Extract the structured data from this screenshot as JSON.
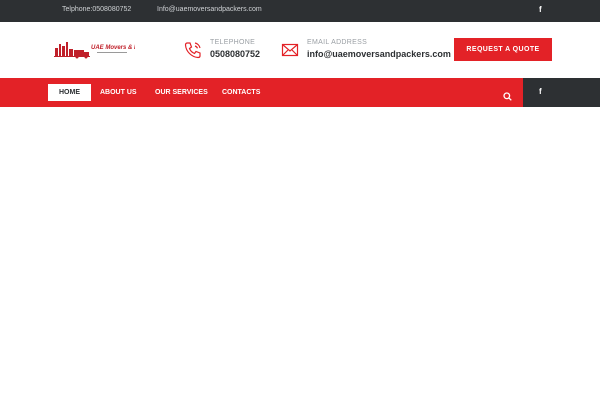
{
  "topbar": {
    "phone_text": "Telphone:0508080752",
    "email_text": "Info@uaemoversandpackers.com",
    "facebook_glyph": "f"
  },
  "header": {
    "telephone_label": "TELEPHONE",
    "telephone_value": "0508080752",
    "email_label": "EMAIL ADDRESS",
    "email_value": "info@uaemoversandpackers.com",
    "quote_button": "REQUEST A QUOTE"
  },
  "nav": {
    "items": [
      {
        "label": "HOME"
      },
      {
        "label": "ABOUT US"
      },
      {
        "label": "OUR SERVICES"
      },
      {
        "label": "CONTACTS"
      }
    ],
    "facebook_glyph": "f"
  },
  "icons": {
    "phone": "phone-icon",
    "email": "envelope-icon",
    "search": "search-icon",
    "facebook": "facebook-icon"
  },
  "colors": {
    "brand_red": "#e32227",
    "dark": "#2d3033",
    "white": "#ffffff"
  }
}
